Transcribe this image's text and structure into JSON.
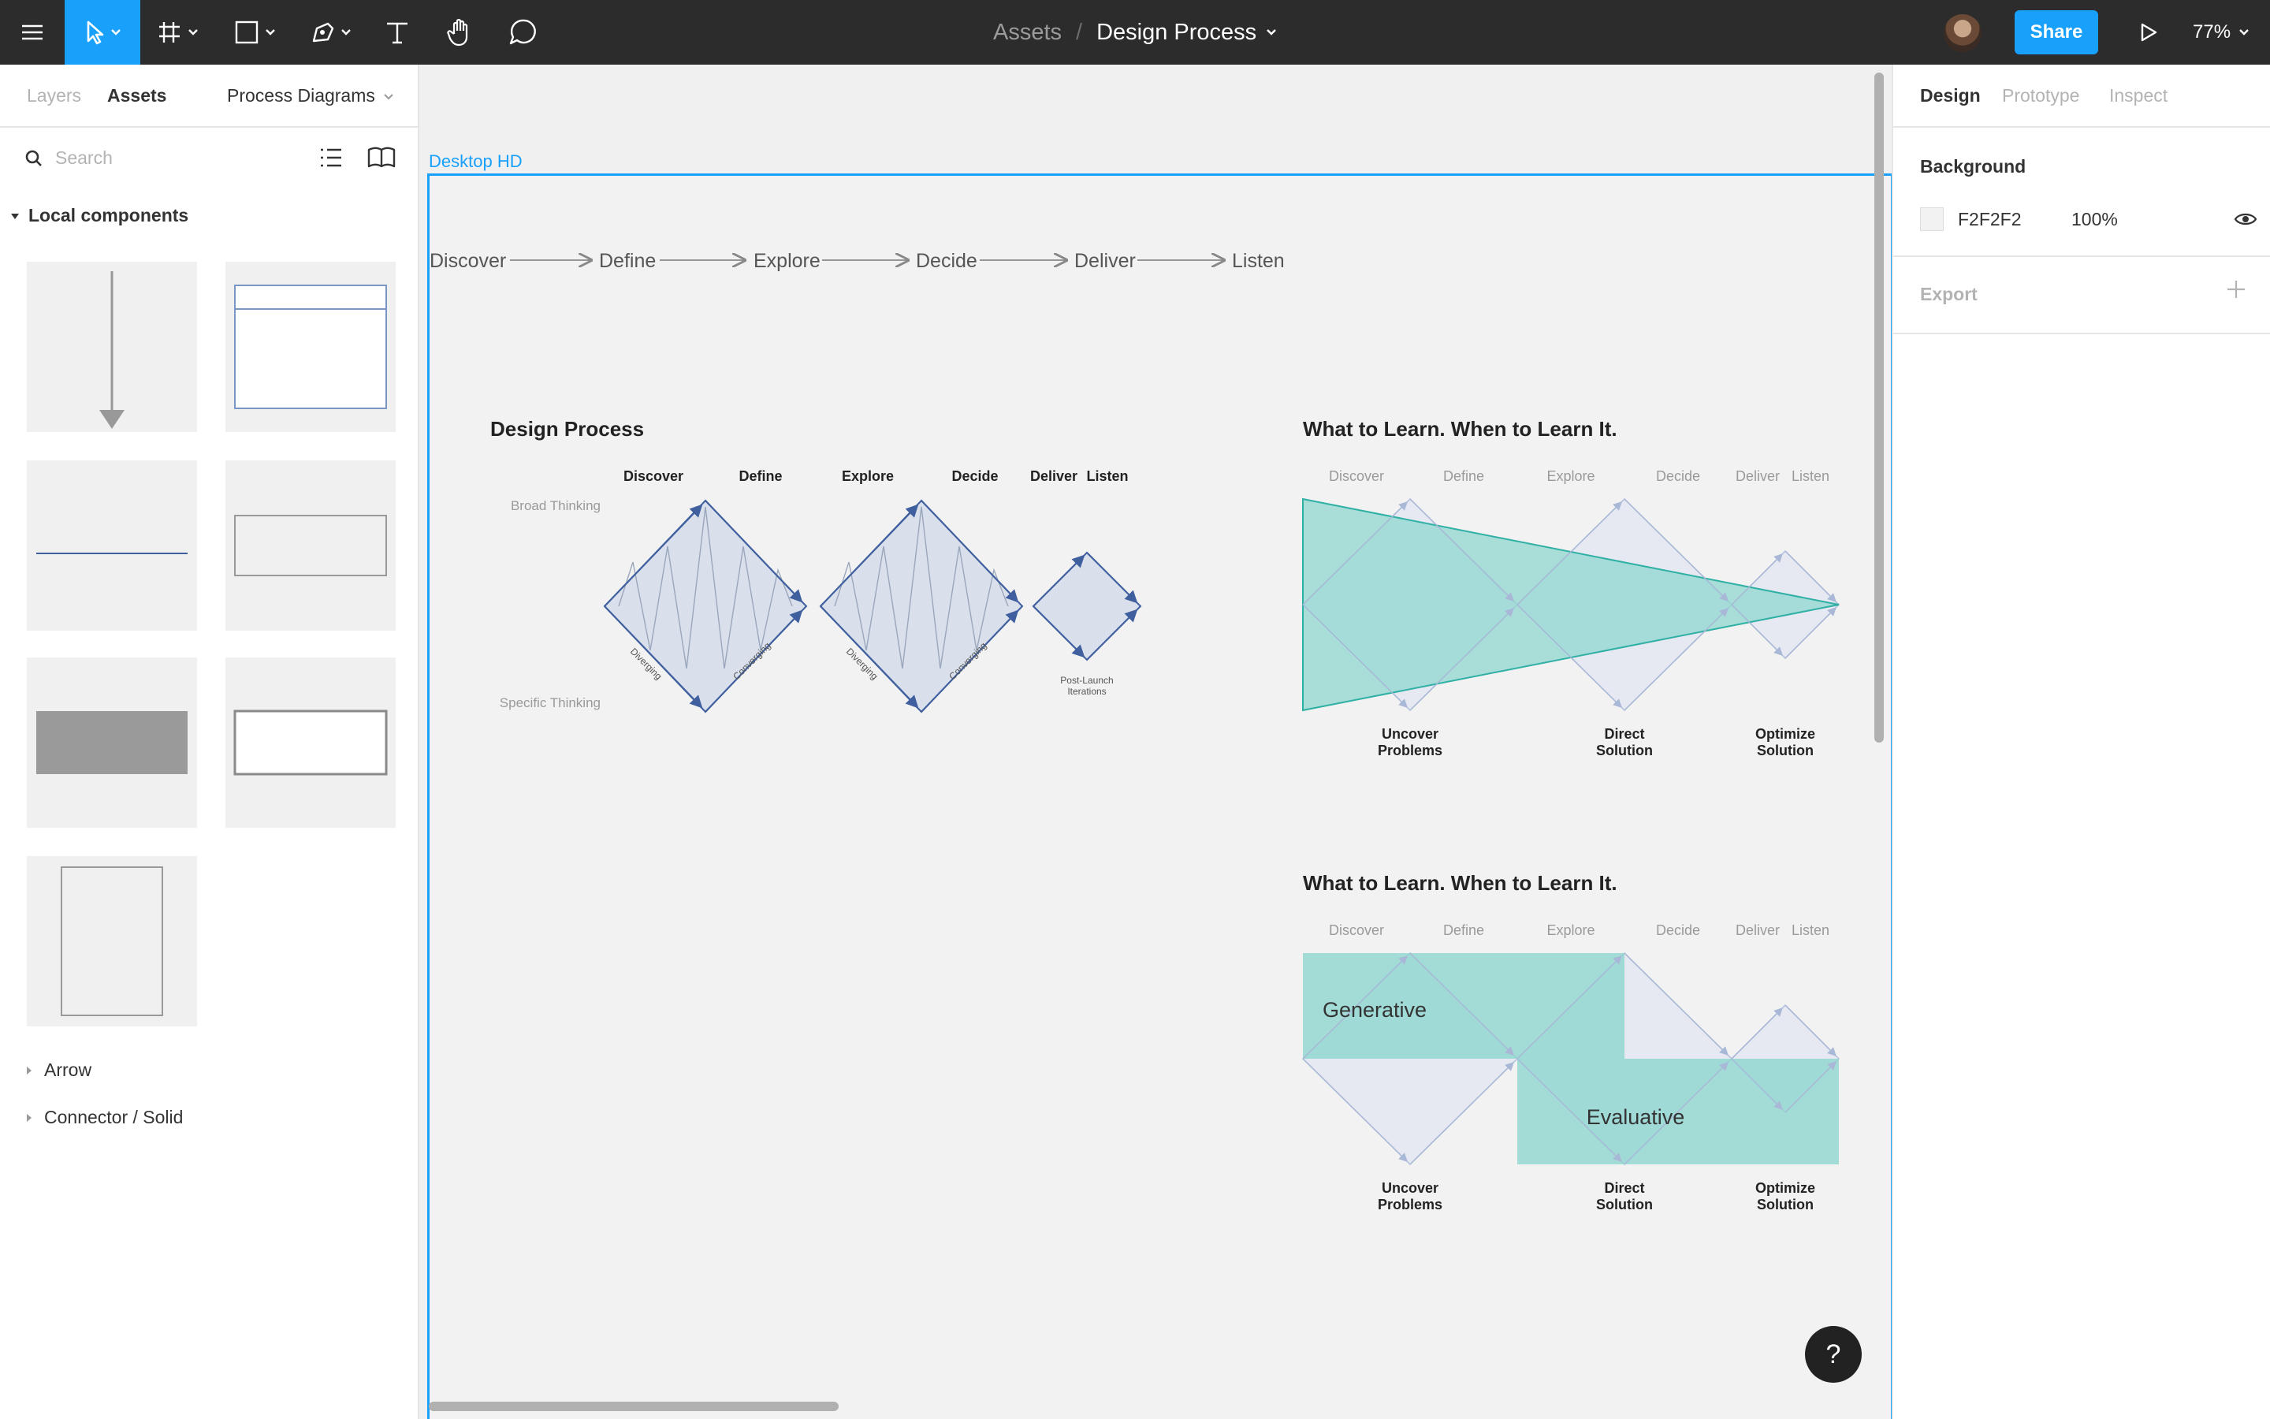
{
  "toolbar": {
    "breadcrumb_project": "Assets",
    "breadcrumb_separator": "/",
    "breadcrumb_file": "Design Process",
    "share_label": "Share",
    "zoom_level": "77%"
  },
  "left_panel": {
    "tabs": {
      "layers": "Layers",
      "assets": "Assets"
    },
    "page_set": "Process Diagrams",
    "search_placeholder": "Search",
    "section_title": "Local components",
    "groups": [
      "Arrow",
      "Connector / Solid"
    ]
  },
  "canvas": {
    "frame_name": "Desktop HD",
    "process_steps": [
      "Discover",
      "Define",
      "Explore",
      "Decide",
      "Deliver",
      "Listen"
    ],
    "diagram1": {
      "title": "Design Process",
      "phases": [
        "Discover",
        "Define",
        "Explore",
        "Decide",
        "Deliver",
        "Listen"
      ],
      "axis_top": "Broad Thinking",
      "axis_bottom": "Specific Thinking",
      "diverging": "Diverging",
      "converging": "Converging",
      "post_launch_1": "Post-Launch",
      "post_launch_2": "Iterations"
    },
    "diagram2": {
      "title": "What to Learn. When to Learn It.",
      "phases": [
        "Discover",
        "Define",
        "Explore",
        "Decide",
        "Deliver",
        "Listen"
      ],
      "outcomes": [
        [
          "Uncover",
          "Problems"
        ],
        [
          "Direct",
          "Solution"
        ],
        [
          "Optimize",
          "Solution"
        ]
      ]
    },
    "diagram3": {
      "title": "What to Learn. When to Learn It.",
      "phases": [
        "Discover",
        "Define",
        "Explore",
        "Decide",
        "Deliver",
        "Listen"
      ],
      "label_generative": "Generative",
      "label_evaluative": "Evaluative",
      "outcomes": [
        [
          "Uncover",
          "Problems"
        ],
        [
          "Direct",
          "Solution"
        ],
        [
          "Optimize",
          "Solution"
        ]
      ]
    },
    "help_label": "?"
  },
  "right_panel": {
    "tabs": {
      "design": "Design",
      "prototype": "Prototype",
      "inspect": "Inspect"
    },
    "background_title": "Background",
    "background_hex": "F2F2F2",
    "background_opacity": "100%",
    "export_title": "Export"
  },
  "colors": {
    "accent": "#18a0fb",
    "toolbar_bg": "#2c2c2c",
    "canvas_bg": "#f0f0f0",
    "frame_bg": "#f2f2f2",
    "diamond_fill": "#d9e0ec",
    "diamond_stroke": "#3f5f9e",
    "teal": "#8fd6cf"
  }
}
